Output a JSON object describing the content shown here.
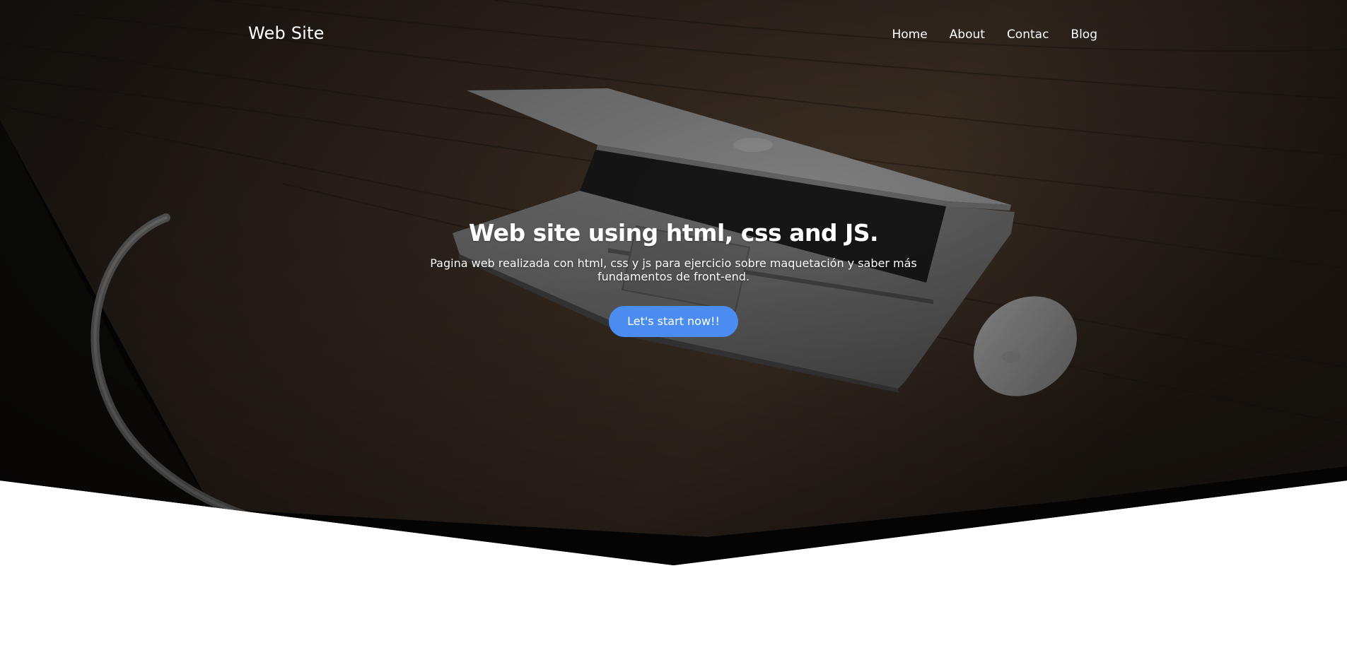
{
  "header": {
    "brand": "Web Site",
    "nav": [
      {
        "label": "Home"
      },
      {
        "label": "About"
      },
      {
        "label": "Contac"
      },
      {
        "label": "Blog"
      }
    ]
  },
  "hero": {
    "title": "Web site using html, css and JS.",
    "subtitle": "Pagina web realizada con html, css y js para ejercicio sobre maquetación y saber más fundamentos de front-end.",
    "cta_label": "Let's start now!!"
  },
  "colors": {
    "accent": "#4a8cf0",
    "text_on_dark": "#ffffff",
    "page_background": "#ffffff"
  }
}
